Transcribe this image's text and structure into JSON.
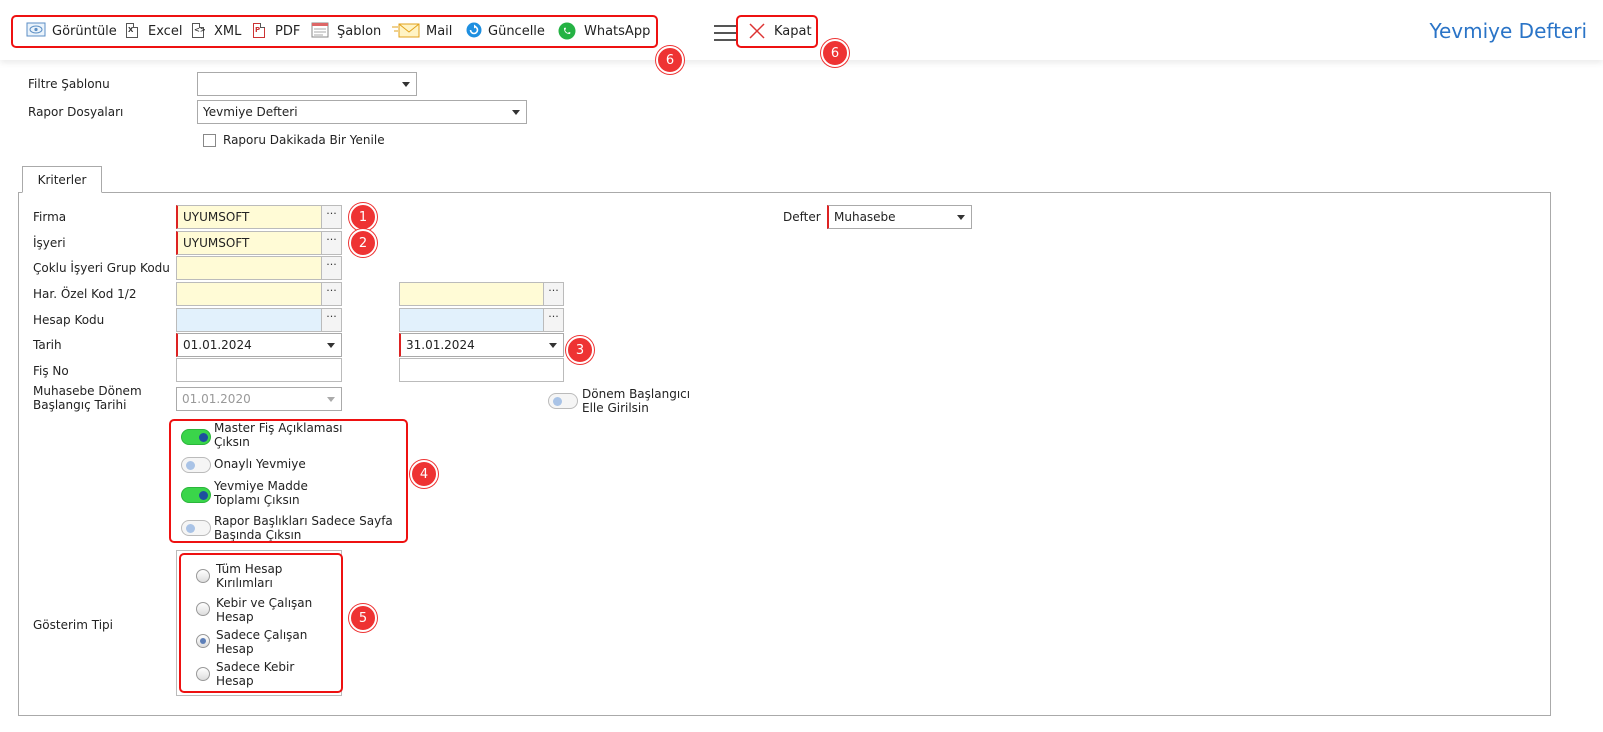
{
  "toolbar": {
    "buttons": [
      {
        "label": "Görüntüle",
        "icon": "preview-icon"
      },
      {
        "label": "Excel",
        "icon": "excel-file-icon"
      },
      {
        "label": "XML",
        "icon": "xml-file-icon"
      },
      {
        "label": "PDF",
        "icon": "pdf-file-icon"
      },
      {
        "label": "Şablon",
        "icon": "template-icon"
      },
      {
        "label": "Mail",
        "icon": "mail-envelope-icon"
      },
      {
        "label": "Güncelle",
        "icon": "refresh-icon"
      },
      {
        "label": "WhatsApp",
        "icon": "whatsapp-icon"
      }
    ],
    "close_label": "Kapat",
    "menu_icon": "hamburger-menu-icon",
    "close_icon": "close-x-icon"
  },
  "page_title": "Yevmiye Defteri",
  "top_form": {
    "filter_template_label": "Filtre Şablonu",
    "filter_template_value": "",
    "report_files_label": "Rapor Dosyaları",
    "report_files_value": "Yevmiye Defteri",
    "refresh_checkbox_label": "Raporu Dakikada Bir Yenile"
  },
  "tab_label": "Kriterler",
  "criteria": {
    "firma_label": "Firma",
    "firma_value": "UYUMSOFT",
    "isyeri_label": "İşyeri",
    "isyeri_value": "UYUMSOFT",
    "coklu_label": "Çoklu İşyeri Grup Kodu",
    "coklu_value": "",
    "ozel_kod_label": "Har. Özel Kod 1/2",
    "hesap_kodu_label": "Hesap Kodu",
    "tarih_label": "Tarih",
    "tarih_start": "01.01.2024",
    "tarih_end": "31.01.2024",
    "fis_no_label": "Fiş No",
    "donem_label_1": "Muhasebe Dönem",
    "donem_label_2": "Başlangıç Tarihi",
    "donem_value": "01.01.2020",
    "donem_elle_label_1": "Dönem Başlangıcı",
    "donem_elle_label_2": "Elle Girilsin",
    "defter_label": "Defter",
    "defter_value": "Muhasebe",
    "dots": "···"
  },
  "toggles": [
    {
      "line1": "Master Fiş Açıklaması",
      "line2": "Çıksın",
      "on": true
    },
    {
      "line1": "Onaylı Yevmiye",
      "line2": "",
      "on": false
    },
    {
      "line1": "Yevmiye Madde",
      "line2": "Toplamı Çıksın",
      "on": true
    },
    {
      "line1": "Rapor Başlıkları Sadece Sayfa",
      "line2": "Başında Çıksın",
      "on": false
    }
  ],
  "gosterim": {
    "label": "Gösterim Tipi",
    "options": [
      {
        "line1": "Tüm Hesap",
        "line2": "Kırılımları",
        "selected": false
      },
      {
        "line1": "Kebir ve Çalışan",
        "line2": "Hesap",
        "selected": false
      },
      {
        "line1": "Sadece Çalışan",
        "line2": "Hesap",
        "selected": true
      },
      {
        "line1": "Sadece Kebir",
        "line2": "Hesap",
        "selected": false
      }
    ]
  },
  "annotations": [
    "1",
    "2",
    "3",
    "4",
    "5",
    "6",
    "6"
  ],
  "colors": {
    "accent": "#2a74c7",
    "annotation": "#e11111",
    "toggle_on": "#3ad54a"
  }
}
